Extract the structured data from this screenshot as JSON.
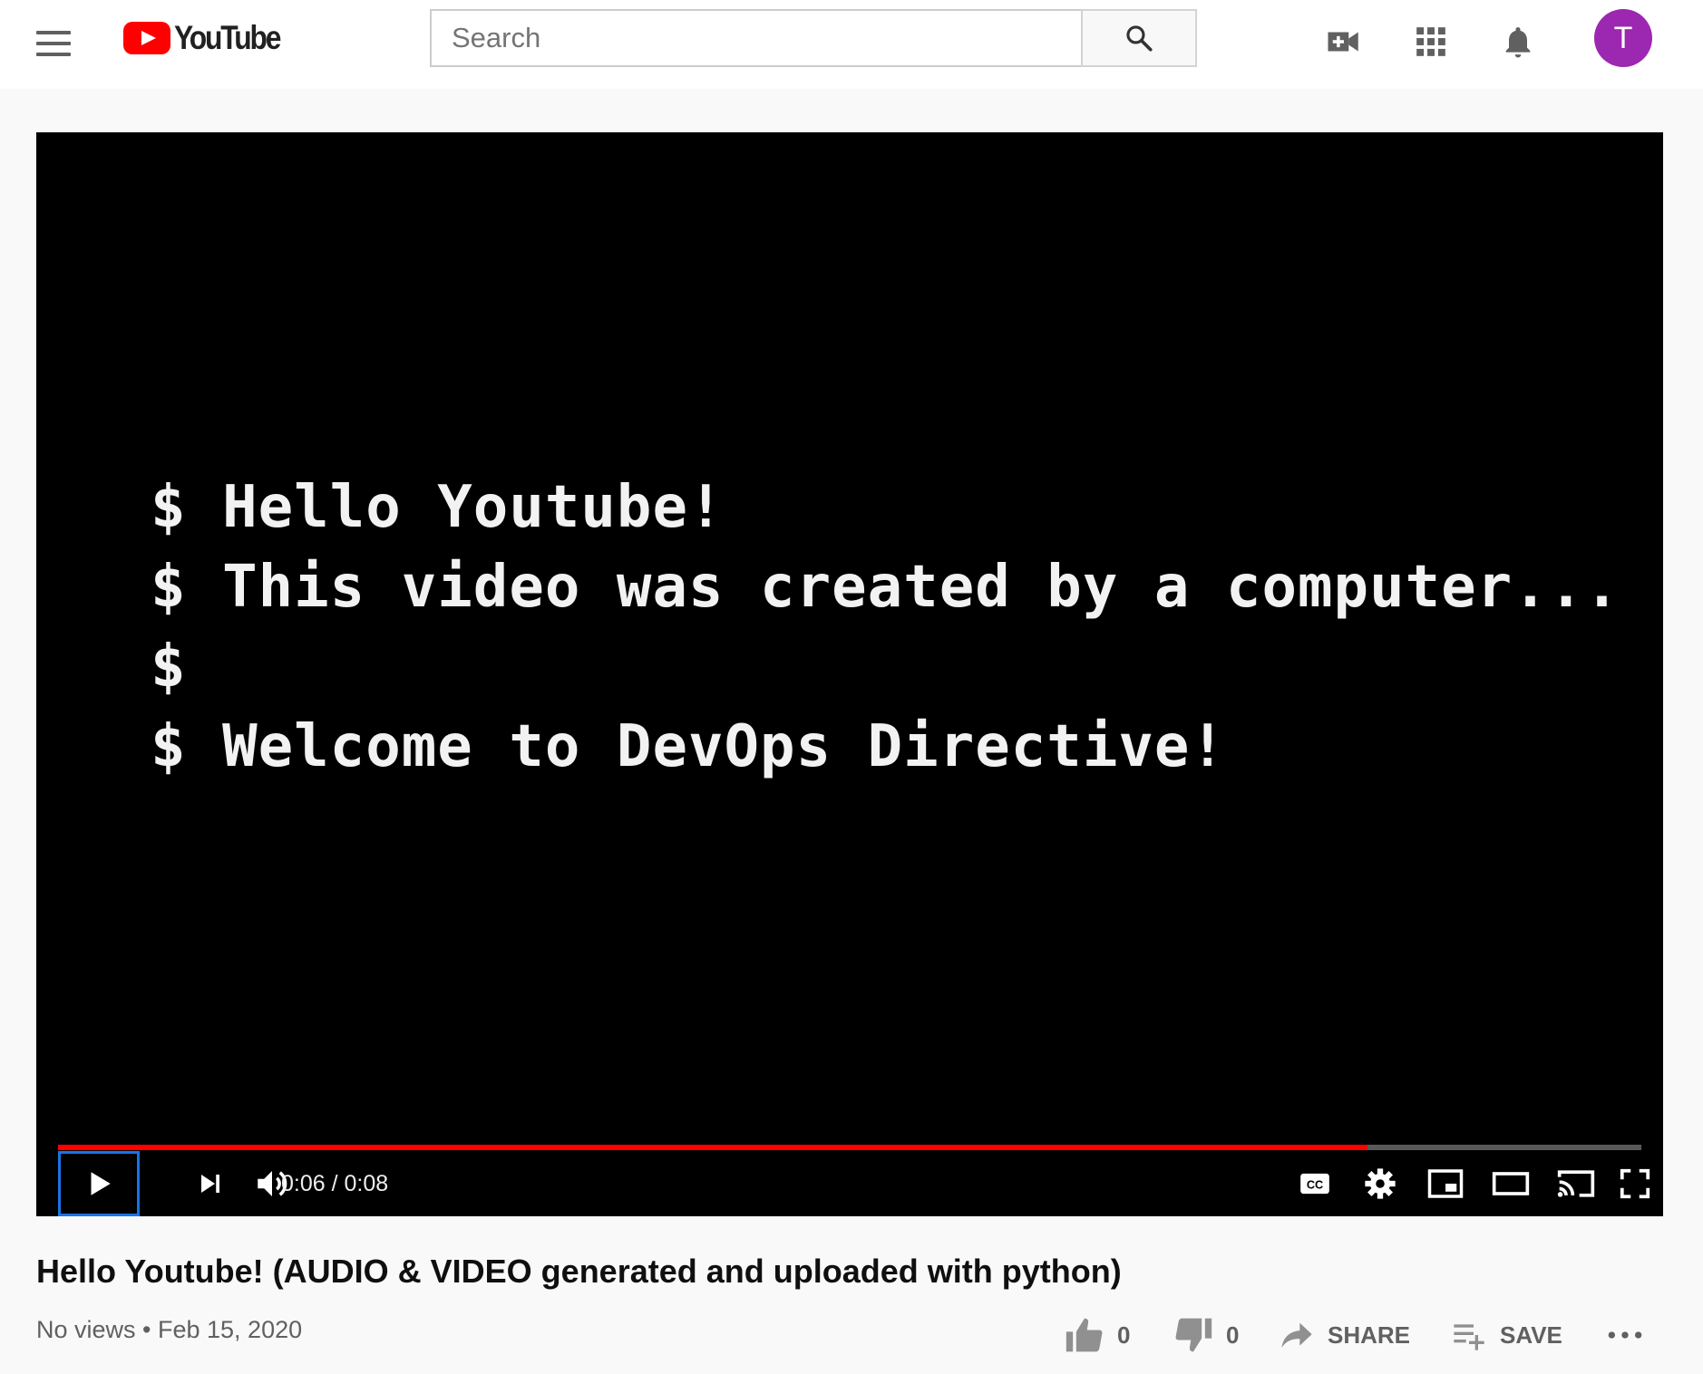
{
  "header": {
    "logo_text": "YouTube",
    "search_placeholder": "Search",
    "avatar_initial": "T",
    "avatar_color": "#9c27b0"
  },
  "player": {
    "video_text_lines": [
      "$ Hello Youtube!",
      "$ This video was created by a computer...",
      "$",
      "$ Welcome to DevOps Directive!"
    ],
    "current_time": "0:06",
    "duration": "0:08",
    "time_display": "0:06 / 0:08",
    "progress_fraction": 0.827,
    "progress_color": "#ff0000"
  },
  "video": {
    "title": "Hello Youtube! (AUDIO & VIDEO generated and uploaded with python)",
    "views": "No views",
    "date": "Feb 15, 2020",
    "meta_line": "No views • Feb 15, 2020",
    "likes": "0",
    "dislikes": "0",
    "share_label": "SHARE",
    "save_label": "SAVE"
  },
  "icons": [
    "menu-icon",
    "youtube-logo-icon",
    "search-icon",
    "create-video-icon",
    "apps-grid-icon",
    "notifications-bell-icon",
    "play-icon",
    "next-icon",
    "volume-icon",
    "captions-icon",
    "settings-gear-icon",
    "miniplayer-icon",
    "theater-mode-icon",
    "cast-icon",
    "fullscreen-icon",
    "thumbs-up-icon",
    "thumbs-down-icon",
    "share-arrow-icon",
    "save-playlist-icon",
    "more-options-icon"
  ]
}
